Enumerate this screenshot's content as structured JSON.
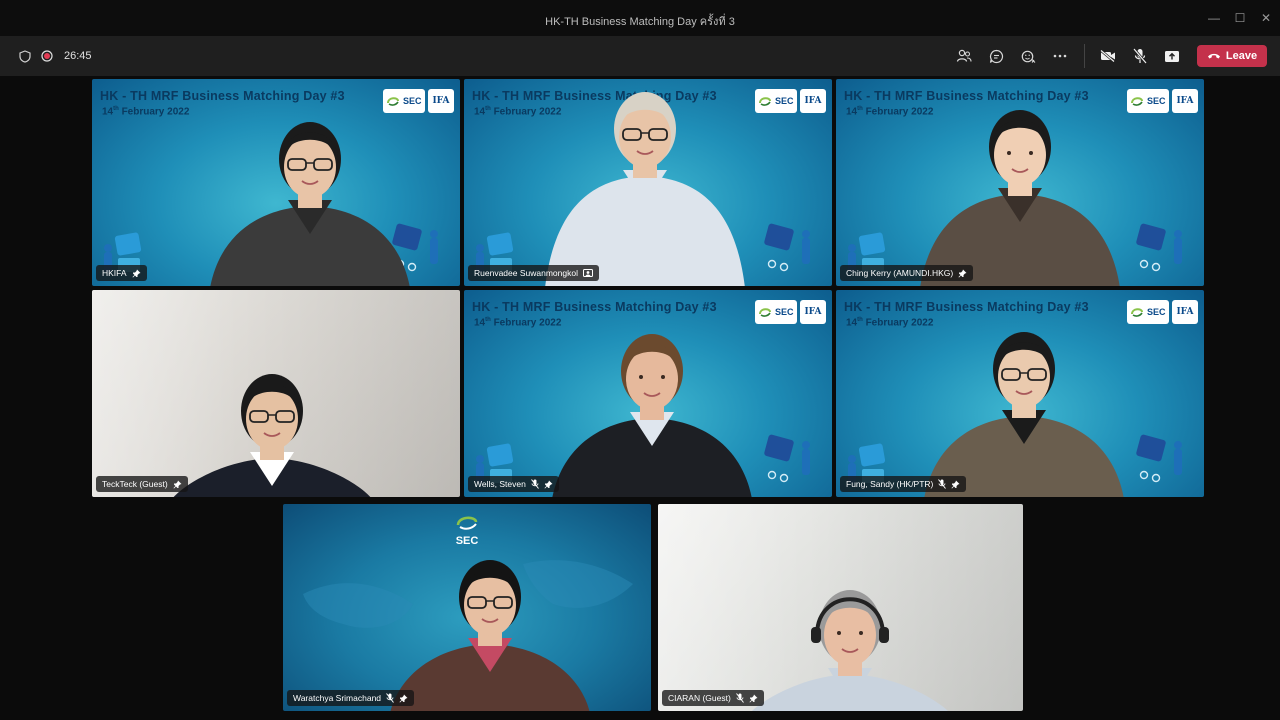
{
  "window": {
    "title": "HK-TH Business Matching Day ครั้งที่ 3",
    "minimize": "—",
    "maximize": "☐",
    "close": "✕"
  },
  "toolbar": {
    "timer": "26:45",
    "icons": [
      "shield-icon",
      "recording-icon",
      "participants-icon",
      "chat-icon",
      "reactions-icon",
      "more-icon",
      "camera-off-icon",
      "mic-off-icon",
      "share-icon"
    ],
    "leave_label": "Leave",
    "leave_color": "#c4314b"
  },
  "meeting": {
    "banner_title": "HK - TH MRF Business Matching Day #3",
    "banner_date_prefix": "14",
    "banner_date_sup": "th",
    "banner_date_suffix": " February 2022",
    "logo_sec": "SEC",
    "logo_ifa": "IFA",
    "sec_overlay": "SEC"
  },
  "participants": [
    {
      "name": "HKIFA",
      "muted": false,
      "pinned": true
    },
    {
      "name": "Ruenvadee Suwanmongkol",
      "muted": false,
      "pinned": false,
      "presenter": true
    },
    {
      "name": "Ching Kerry (AMUNDI.HKG)",
      "muted": false,
      "pinned": true
    },
    {
      "name": "TeckTeck (Guest)",
      "muted": false,
      "pinned": true
    },
    {
      "name": "Wells, Steven",
      "muted": true,
      "pinned": true
    },
    {
      "name": "Fung, Sandy (HK/PTR)",
      "muted": true,
      "pinned": true
    },
    {
      "name": "Waratchya Srimachand",
      "muted": true,
      "pinned": true
    },
    {
      "name": "CIARAN (Guest)",
      "muted": true,
      "pinned": true
    }
  ]
}
